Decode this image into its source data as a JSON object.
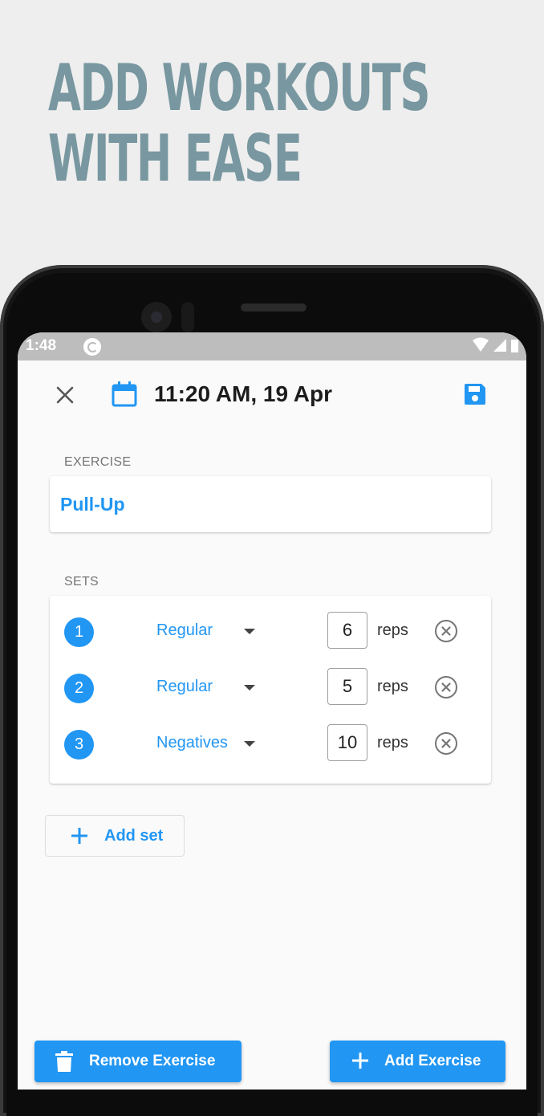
{
  "promo": {
    "headline_line1": "ADD WORKOUTS",
    "headline_line2": "WITH EASE"
  },
  "statusbar": {
    "time": "1:48"
  },
  "appbar": {
    "datetime": "11:20 AM, 19 Apr"
  },
  "exercise": {
    "section_label": "EXERCISE",
    "name": "Pull-Up"
  },
  "sets": {
    "section_label": "SETS",
    "rows": [
      {
        "number": "1",
        "type": "Regular",
        "reps": "6",
        "unit": "reps"
      },
      {
        "number": "2",
        "type": "Regular",
        "reps": "5",
        "unit": "reps"
      },
      {
        "number": "3",
        "type": "Negatives",
        "reps": "10",
        "unit": "reps"
      }
    ]
  },
  "add_set_label": "Add set",
  "actions": {
    "remove_exercise": "Remove Exercise",
    "add_exercise": "Add Exercise"
  },
  "colors": {
    "accent": "#2196f3",
    "headline": "#7897a0",
    "background": "#eeeeee"
  }
}
